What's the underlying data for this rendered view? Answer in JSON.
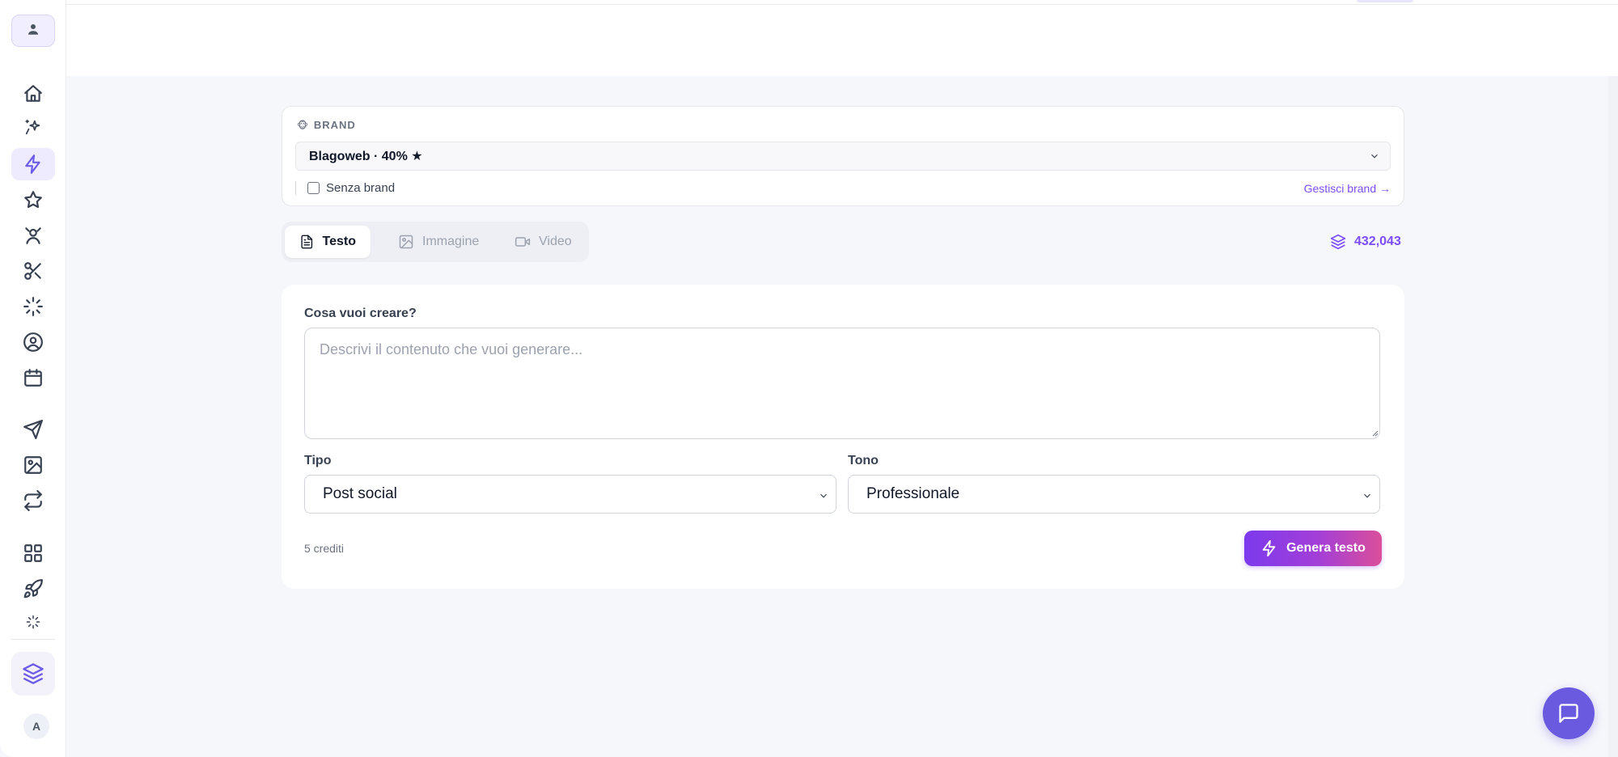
{
  "sidebar": {
    "top_avatar_icon": "user-icon",
    "items": [
      {
        "icon": "home-icon",
        "active": false
      },
      {
        "icon": "sparkles-icon",
        "active": false
      },
      {
        "icon": "lightning-icon",
        "active": true
      },
      {
        "icon": "star-icon",
        "active": false
      },
      {
        "icon": "person-icon",
        "active": false
      },
      {
        "icon": "scissors-icon",
        "active": false
      },
      {
        "icon": "loader-icon",
        "active": false
      },
      {
        "icon": "user-circle-icon",
        "active": false
      },
      {
        "icon": "calendar-icon",
        "active": false
      },
      {
        "icon": "send-icon",
        "active": false
      },
      {
        "icon": "image-icon",
        "active": false
      },
      {
        "icon": "repeat-icon",
        "active": false
      },
      {
        "icon": "grid-icon",
        "active": false
      },
      {
        "icon": "rocket-icon",
        "active": false
      },
      {
        "icon": "loader-small-icon",
        "active": false
      }
    ],
    "credits_icon": "layers-icon",
    "user_initial": "A"
  },
  "brand": {
    "label": "BRAND",
    "selected": "Blagoweb · 40% ★",
    "no_brand_label": "Senza brand",
    "no_brand_checked": false,
    "manage_link": "Gestisci brand →"
  },
  "tabs": [
    {
      "label": "Testo",
      "icon": "document-icon",
      "active": true
    },
    {
      "label": "Immagine",
      "icon": "image-icon",
      "active": false
    },
    {
      "label": "Video",
      "icon": "video-icon",
      "active": false
    }
  ],
  "credits_balance": "432,043",
  "form": {
    "prompt_label": "Cosa vuoi creare?",
    "prompt_placeholder": "Descrivi il contenuto che vuoi generare...",
    "prompt_value": "",
    "type_label": "Tipo",
    "type_value": "Post social",
    "tone_label": "Tono",
    "tone_value": "Professionale",
    "cost": "5 crediti",
    "generate_label": "Genera testo"
  },
  "chat_icon": "chat-bubble-icon",
  "colors": {
    "accent": "#7c4dff",
    "sidebar_active_bg": "#eeebff",
    "button_gradient_start": "#7c3aed",
    "button_gradient_end": "#db4f9a",
    "chat_fab": "#6a5ae0"
  }
}
